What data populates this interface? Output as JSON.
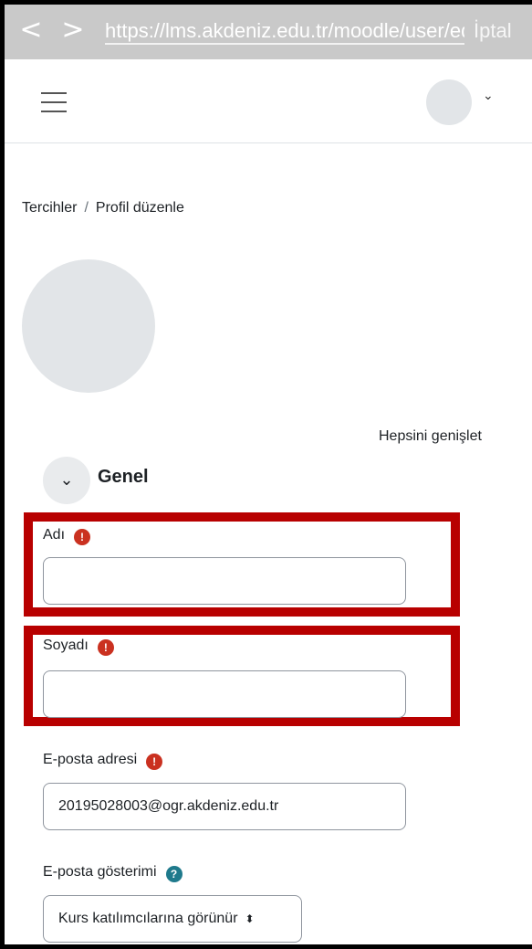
{
  "browser": {
    "back_glyph": "<",
    "forward_glyph": ">",
    "url": "https://lms.akdeniz.edu.tr/moodle/user/edit.php",
    "cancel_label": "İptal"
  },
  "header": {
    "caret": "⌄"
  },
  "breadcrumb": {
    "items": [
      "Tercihler",
      "Profil düzenle"
    ],
    "separator": "/"
  },
  "form": {
    "expand_all_label": "Hepsini genişlet",
    "section": {
      "toggle_glyph": "⌄",
      "title": "Genel"
    },
    "fields": {
      "firstname": {
        "label": "Adı",
        "value": "",
        "required_glyph": "!"
      },
      "lastname": {
        "label": "Soyadı",
        "value": "",
        "required_glyph": "!"
      },
      "email": {
        "label": "E-posta adresi",
        "value": "20195028003@ogr.akdeniz.edu.tr",
        "required_glyph": "!"
      },
      "email_display": {
        "label": "E-posta gösterimi",
        "value": "Kurs katılımcılarına görünür",
        "help_glyph": "?",
        "arrow_glyph": "⬍"
      }
    }
  },
  "colors": {
    "highlight": "#b80000",
    "required": "#ca3120",
    "help": "#1f7a8c"
  }
}
